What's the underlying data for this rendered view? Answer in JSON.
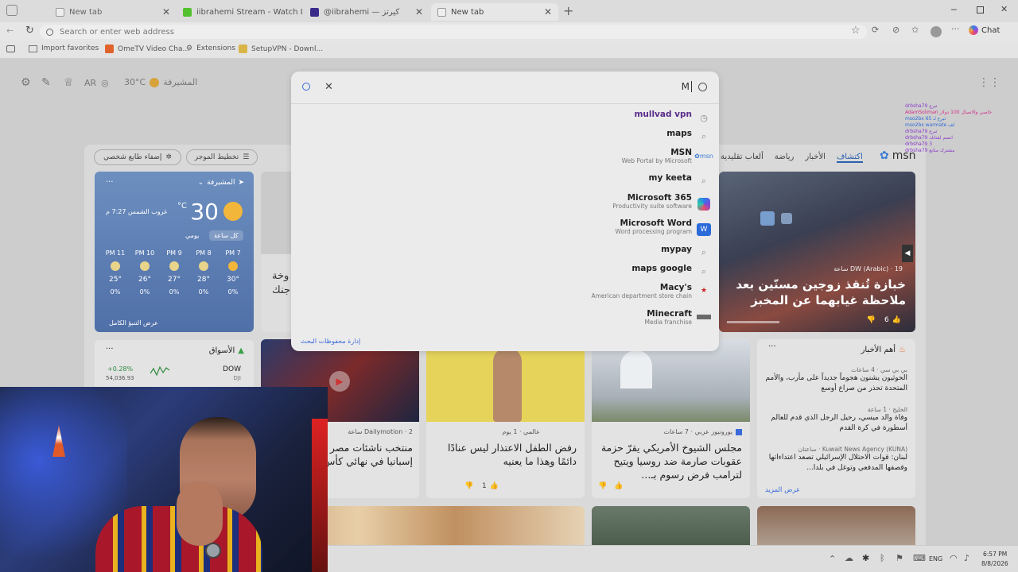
{
  "tabs": [
    {
      "title": "New tab"
    },
    {
      "title": "iibrahemi Stream - Watch Live on"
    },
    {
      "title": "@iibrahemi — كيرتز"
    },
    {
      "title": "New tab"
    }
  ],
  "omnibox": {
    "placeholder": "Search or enter web address"
  },
  "toolbar": {
    "chat_label": "Chat"
  },
  "favorites": [
    {
      "label": "Import favorites"
    },
    {
      "label": "OmeTV Video Cha..."
    },
    {
      "label": "Extensions"
    },
    {
      "label": "SetupVPN - Downl..."
    }
  ],
  "page_header": {
    "location": "المشيرفة",
    "temp": "30°C",
    "lang": "AR"
  },
  "search": {
    "query": "M",
    "manage_label": "إدارة محفوظات البحث",
    "suggestions": [
      {
        "title": "mullvad vpn",
        "subtitle": "",
        "icon": "history-icon"
      },
      {
        "title": "maps",
        "subtitle": "",
        "icon": "search-icon"
      },
      {
        "title": "MSN",
        "subtitle": "Web Portal by Microsoft",
        "icon": "msn-logo-icon"
      },
      {
        "title": "my keeta",
        "subtitle": "",
        "icon": "search-icon"
      },
      {
        "title": "Microsoft 365",
        "subtitle": "Productivity suite software",
        "icon": "m365-logo-icon"
      },
      {
        "title": "Microsoft Word",
        "subtitle": "Word processing program",
        "icon": "word-logo-icon"
      },
      {
        "title": "mypay",
        "subtitle": "",
        "icon": "search-icon"
      },
      {
        "title": "maps google",
        "subtitle": "",
        "icon": "search-icon"
      },
      {
        "title": "Macy's",
        "subtitle": "American department store chain",
        "icon": "macys-logo-icon"
      },
      {
        "title": "Minecraft",
        "subtitle": "Media franchise",
        "icon": "minecraft-logo-icon"
      }
    ]
  },
  "feed_nav": {
    "brand": "msn",
    "tabs": [
      "اكتشاف",
      "الأخبار",
      "رياضة",
      "ألعاب تقليدية"
    ],
    "personalize": "إضفاء طابع شخصي",
    "layout": "تخطيط الموجز"
  },
  "weather": {
    "location": "المشيرفة",
    "temp": "30",
    "unit": "°C",
    "sunset": "غروب الشمس 7:27 م",
    "tab_hourly": "كل ساعة",
    "tab_daily": "يومي",
    "hours": [
      {
        "time": "PM 11",
        "temp": "25°",
        "precip": "0%"
      },
      {
        "time": "PM 10",
        "temp": "26°",
        "precip": "0%"
      },
      {
        "time": "PM 9",
        "temp": "27°",
        "precip": "0%"
      },
      {
        "time": "PM 8",
        "temp": "28°",
        "precip": "0%"
      },
      {
        "time": "PM 7",
        "temp": "30°",
        "precip": "0%"
      }
    ],
    "full_forecast": "عرض التنبؤ الكامل"
  },
  "hero": {
    "source": "DW (Arabic) · 19 ساعة",
    "headline": "خبازة تُنقذ زوجين مسنّين بعد ملاحظة غيابهما عن المخبز",
    "likes": "6"
  },
  "markets": {
    "title": "الأسواق",
    "symbol": "DOW",
    "exchange": "DJI",
    "change": "+0.28%",
    "value": "54,036.93"
  },
  "top_stories": {
    "title": "أهم الأخبار",
    "items": [
      {
        "source": "بي بي سي · 4 ساعات",
        "headline": "الحوثيون يشنون هجوماً جديداً على مأرب، والأمم المتحدة تحذر من صراع أوسع"
      },
      {
        "source": "الخليج · 1 ساعة",
        "headline": "وفاة والد ميسي، رحيل الرجل الذي قدم للعالم أسطورة في كرة القدم"
      },
      {
        "source": "Kuwait News Agency (KUNA) · ساعتان",
        "headline": "لبنان: قوات الاحتلال الإسرائيلي تصعد اعتداءاتها وقصفها المدفعي وتوغل في بلدا..."
      }
    ],
    "more": "عرض المزيد"
  },
  "news_cards": [
    {
      "source": "Dailymotion · 2 ساعة",
      "headline": "منتخب ناشئات مصر يخسر أمام إسبانيا في نهائي كأس العالم..",
      "likes": ""
    },
    {
      "source": "عالمي · 1 يوم",
      "headline": "رفض الطفل الاعتذار ليس عنادًا دائمًا وهذا ما يعنيه",
      "likes": "1"
    },
    {
      "source": "يورونيوز عربي · 7 ساعات",
      "headline": "مجلس الشيوخ الأمريكي يقرّ حزمة عقوبات صارمة ضد روسيا ويتيح لترامب فرض رسوم بـ...",
      "likes": ""
    }
  ],
  "partial_card": {
    "line1": "وخة",
    "line2": "جنك"
  },
  "taskbar": {
    "lang": "ENG",
    "time": "6:57 PM",
    "date": "8/8/2026"
  },
  "chat_overlay": [
    {
      "text": "drbsha79 تبرع",
      "color": "#8a3cc9"
    },
    {
      "text": "AdamSoliman خاصي والاتصال 100 دولار",
      "color": "#d2308a"
    },
    {
      "text": "mso2bx تبرع لـ 65",
      "color": "#2d6ad6"
    },
    {
      "text": "mso2bx warmate لف",
      "color": "#2d6ad6"
    },
    {
      "text": "drbsha79 تبرع",
      "color": "#8a3cc9"
    },
    {
      "text": "drbsha79 انضم لقناتك",
      "color": "#8a3cc9"
    },
    {
      "text": "drbsha79 3",
      "color": "#8a3cc9"
    },
    {
      "text": "drbsha79 مشترك متابع",
      "color": "#8a3cc9"
    }
  ]
}
